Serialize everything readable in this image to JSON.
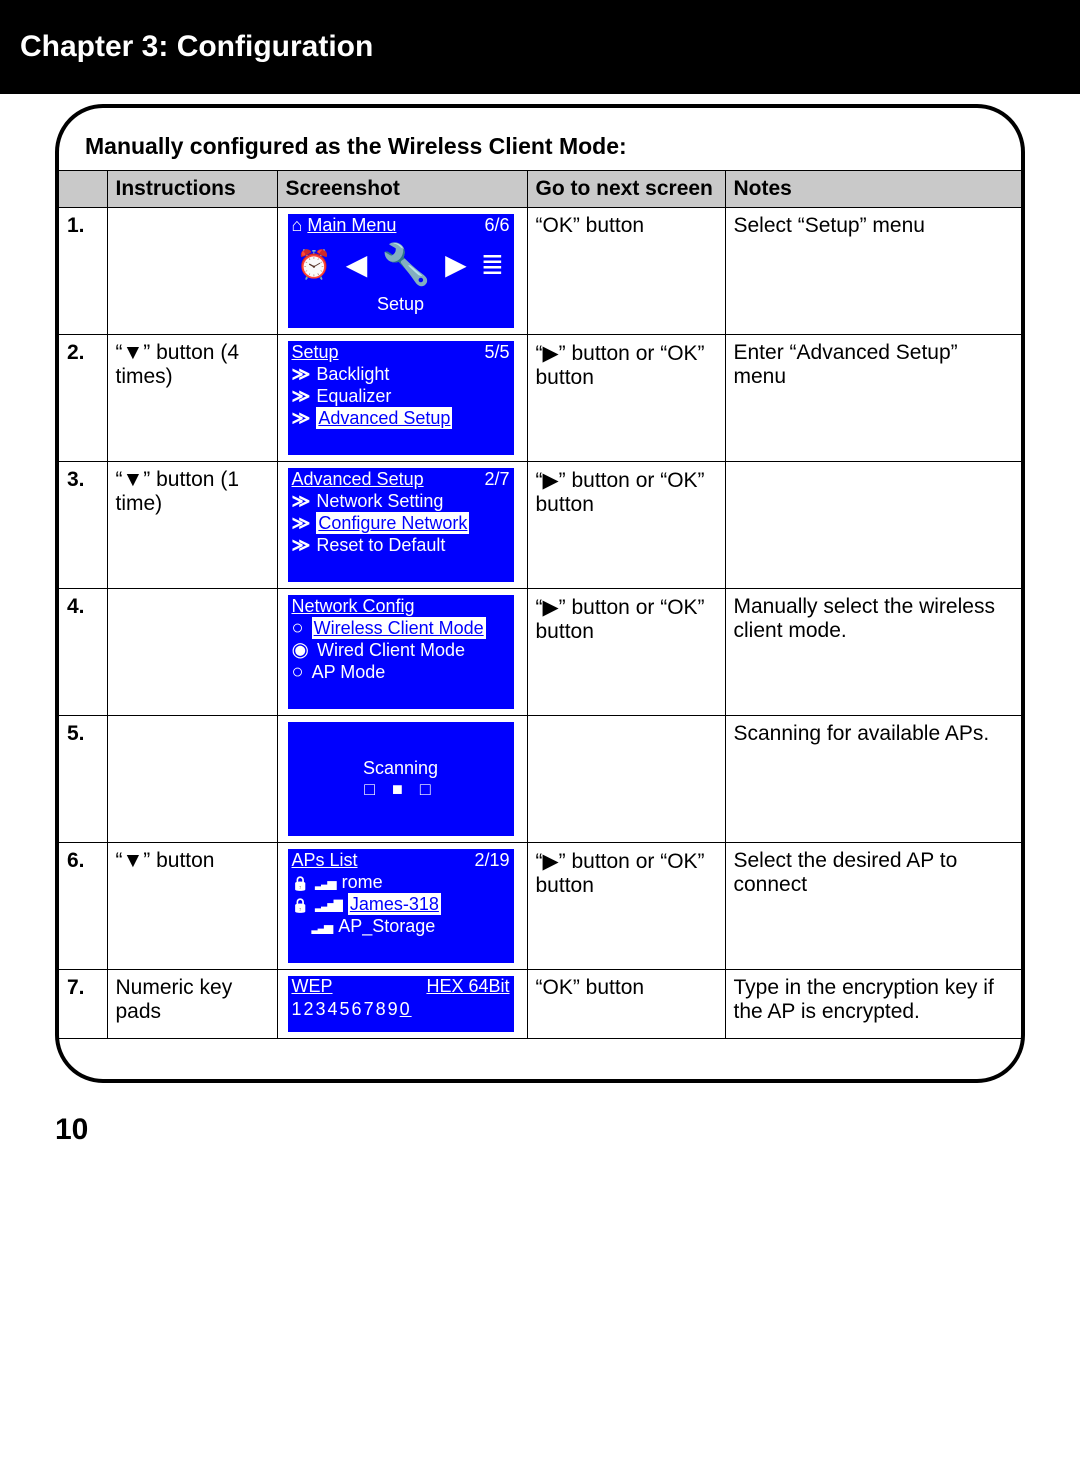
{
  "header": "Chapter 3: Configuration",
  "panel_title": "Manually configured as the Wireless Client Mode:",
  "columns": [
    "",
    "Instructions",
    "Screenshot",
    "Go to next screen",
    "Notes"
  ],
  "page_number": "10",
  "rows": [
    {
      "num": "1.",
      "instructions": "",
      "next": "“OK” button",
      "notes": "Select “Setup” menu",
      "screen": {
        "type": "main_menu",
        "title": "Main Menu",
        "page": "6/6",
        "footer": "Setup"
      }
    },
    {
      "num": "2.",
      "instructions": "“▼” button (4 times)",
      "next": "“▶” button or “OK” button",
      "notes": "Enter “Advanced Setup” menu",
      "screen": {
        "type": "menu",
        "title": "Setup",
        "page": "5/5",
        "items": [
          {
            "label": "Backlight",
            "selected": false
          },
          {
            "label": "Equalizer",
            "selected": false
          },
          {
            "label": "Advanced Setup",
            "selected": true
          }
        ]
      }
    },
    {
      "num": "3.",
      "instructions": "“▼” button (1 time)",
      "next": "“▶” button or “OK” button",
      "notes": "",
      "screen": {
        "type": "menu",
        "title": "Advanced Setup",
        "page": "2/7",
        "items": [
          {
            "label": "Network Setting",
            "selected": false
          },
          {
            "label": "Configure Network",
            "selected": true
          },
          {
            "label": "Reset to Default",
            "selected": false
          }
        ]
      }
    },
    {
      "num": "4.",
      "instructions": "",
      "next": "“▶” button or “OK” button",
      "notes": "Manually select the wireless client mode.",
      "screen": {
        "type": "radio",
        "title": "Network Config",
        "items": [
          {
            "label": "Wireless Client Mode",
            "selected": true,
            "filled": false
          },
          {
            "label": "Wired Client Mode",
            "selected": false,
            "filled": true
          },
          {
            "label": "AP Mode",
            "selected": false,
            "filled": false
          }
        ]
      }
    },
    {
      "num": "5.",
      "instructions": "",
      "next": "",
      "notes": "Scanning for available APs.",
      "screen": {
        "type": "scanning",
        "label": "Scanning"
      }
    },
    {
      "num": "6.",
      "instructions": "“▼” button",
      "next": "“▶” button or “OK” button",
      "notes": "Select the desired AP to connect",
      "screen": {
        "type": "aps",
        "title": "APs List",
        "page": "2/19",
        "items": [
          {
            "label": "rome",
            "lock": true,
            "bars": 3,
            "selected": false
          },
          {
            "label": "James-318",
            "lock": true,
            "bars": 4,
            "selected": true
          },
          {
            "label": "AP_Storage",
            "lock": false,
            "bars": 3,
            "selected": false
          }
        ]
      }
    },
    {
      "num": "7.",
      "instructions": "Numeric key pads",
      "next": "“OK” button",
      "notes": "Type in the encryption key if the AP is encrypted.",
      "screen": {
        "type": "wep",
        "title": "WEP",
        "mode": "HEX 64Bit",
        "key": "1234567890"
      }
    }
  ]
}
